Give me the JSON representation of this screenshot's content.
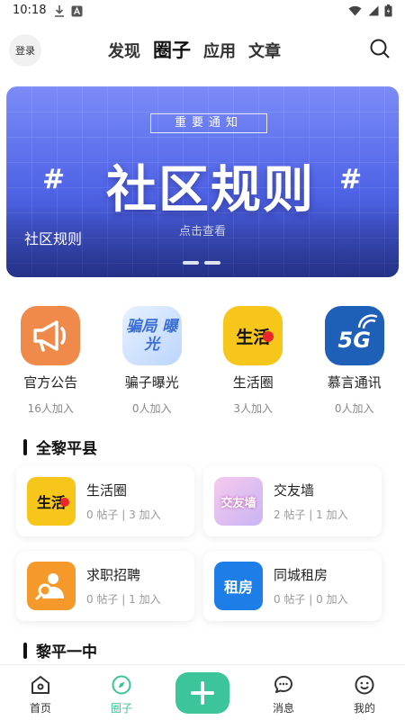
{
  "status_bar": {
    "time": "10:18"
  },
  "header": {
    "login_label": "登录",
    "tabs": [
      {
        "label": "发现"
      },
      {
        "label": "圈子"
      },
      {
        "label": "应用"
      },
      {
        "label": "文章"
      }
    ]
  },
  "banner": {
    "notice": "重要通知",
    "headline": "社区规则",
    "hash": "#",
    "hint": "点击查看",
    "caption": "社区规则"
  },
  "quick_icons": [
    {
      "label": "官方公告",
      "count": "16人加入",
      "icon": "megaphone-icon",
      "color": "#f08a4b"
    },
    {
      "label": "骗子曝光",
      "count": "0人加入",
      "icon": "scam-exposure-icon",
      "color": "#5a8de8",
      "icon_text": "骗局 曝光"
    },
    {
      "label": "生活圈",
      "count": "3人加入",
      "icon": "life-circle-icon",
      "color": "#f7c61a",
      "icon_text": "生活"
    },
    {
      "label": "慕言通讯",
      "count": "0人加入",
      "icon": "5g-icon",
      "color": "#1e5fb8",
      "icon_text": "5G"
    }
  ],
  "sections": [
    {
      "title": "全黎平县",
      "cards": [
        {
          "name": "生活圈",
          "meta": "0 帖子 | 3 加入",
          "icon": "life-circle-icon",
          "color": "#f7c61a",
          "icon_text": "生活"
        },
        {
          "name": "交友墙",
          "meta": "2 帖子 | 1 加入",
          "icon": "friend-wall-icon",
          "color": "#e9a6d8",
          "icon_text": "交友墙"
        },
        {
          "name": "求职招聘",
          "meta": "0 帖子 | 1 加入",
          "icon": "job-search-icon",
          "color": "#f59a2a"
        },
        {
          "name": "同城租房",
          "meta": "0 帖子 | 0 加入",
          "icon": "rent-icon",
          "color": "#1e7ee8",
          "icon_text": "租房"
        }
      ]
    },
    {
      "title": "黎平一中"
    }
  ],
  "tabbar": {
    "items": [
      {
        "label": "首页"
      },
      {
        "label": "圈子"
      },
      {
        "label": "消息"
      },
      {
        "label": "我的"
      }
    ],
    "accent": "#3cc49a"
  }
}
